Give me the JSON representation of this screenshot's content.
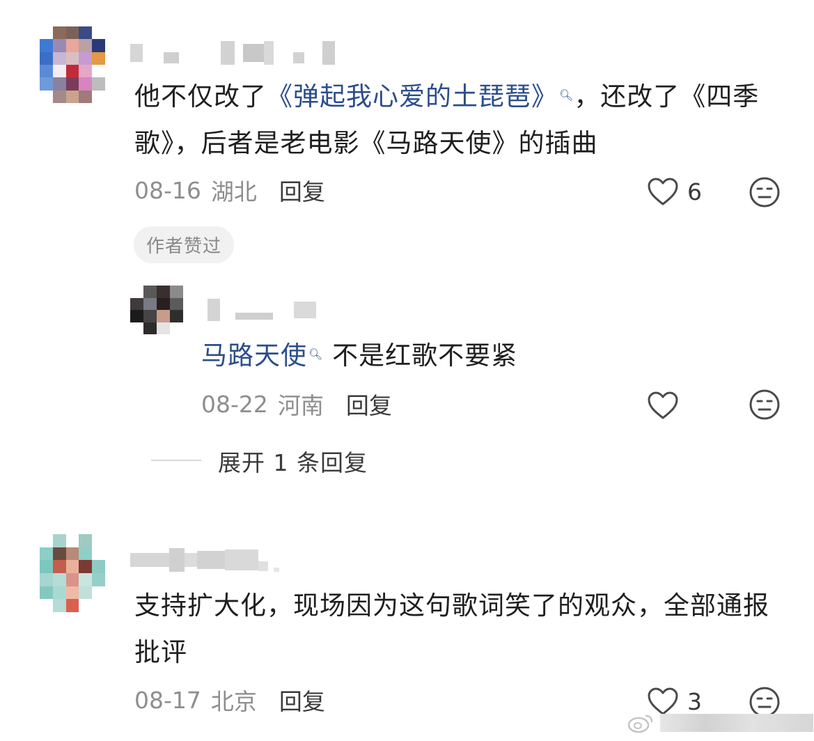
{
  "comments": [
    {
      "text_parts": [
        {
          "t": "他不仅改了",
          "link": false
        },
        {
          "t": "《弹起我心爱的土琵琶》",
          "link": true
        },
        {
          "t": "，还改了《四季歌》，后者是老电影《马路天使》的插曲",
          "link": false
        }
      ],
      "date": "08-16",
      "location": "湖北",
      "reply_label": "回复",
      "like_count": "6",
      "badge": "作者赞过",
      "replies": [
        {
          "text_link": "马路天使",
          "text_rest": " 不是红歌不要紧",
          "date": "08-22",
          "location": "河南",
          "reply_label": "回复"
        }
      ],
      "expand_label": "展开 1 条回复"
    },
    {
      "text": "支持扩大化，现场因为这句歌词笑了的观众，全部通报批评",
      "date": "08-17",
      "location": "北京",
      "reply_label": "回复",
      "like_count": "3"
    }
  ],
  "icons": {
    "like": "heart-outline-icon",
    "dislike": "neutral-face-icon",
    "search_hint": "search-magnifier-icon"
  },
  "colors": {
    "link": "#2c4d8c",
    "meta": "#8e8e8e",
    "text": "#1f1f1f"
  }
}
